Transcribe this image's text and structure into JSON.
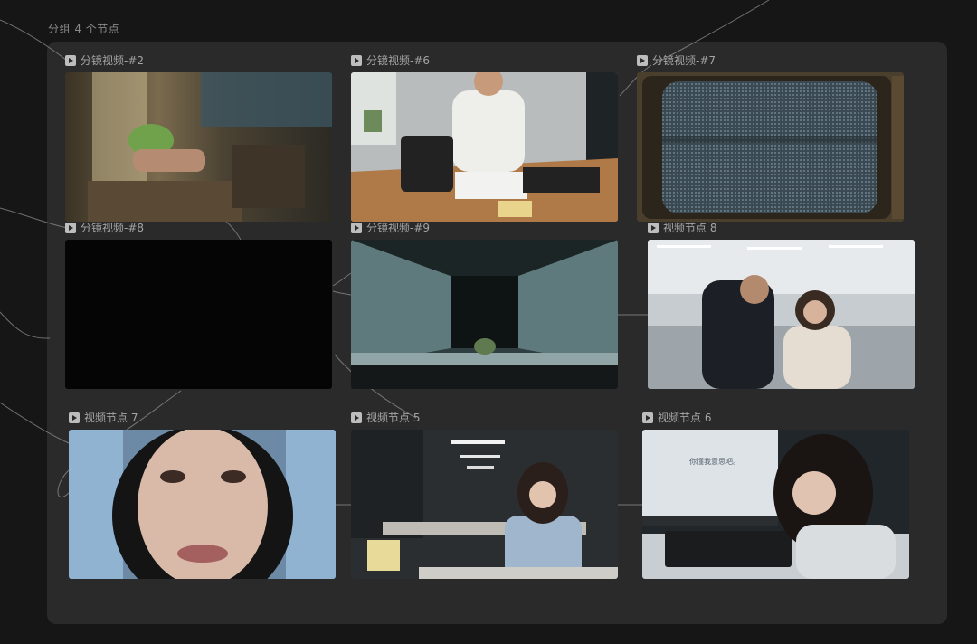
{
  "group": {
    "label": "分组 4 个节点"
  },
  "nodes": [
    {
      "label": "分镜视频-#2",
      "scene": "window-succulent"
    },
    {
      "label": "分镜视频-#6",
      "scene": "office-desk-man"
    },
    {
      "label": "分镜视频-#7",
      "scene": "crt-static"
    },
    {
      "label": "分镜视频-#8",
      "scene": "black-frame"
    },
    {
      "label": "分镜视频-#9",
      "scene": "corridor-plant"
    },
    {
      "label": "视频节点 8",
      "scene": "office-man-woman"
    },
    {
      "label": "视频节点 7",
      "scene": "crying-closeup"
    },
    {
      "label": "视频节点 5",
      "scene": "woman-office-cubicles"
    },
    {
      "label": "视频节点 6",
      "scene": "woman-typing-monitor"
    }
  ],
  "monitor_text": "你懂我意思吧。"
}
